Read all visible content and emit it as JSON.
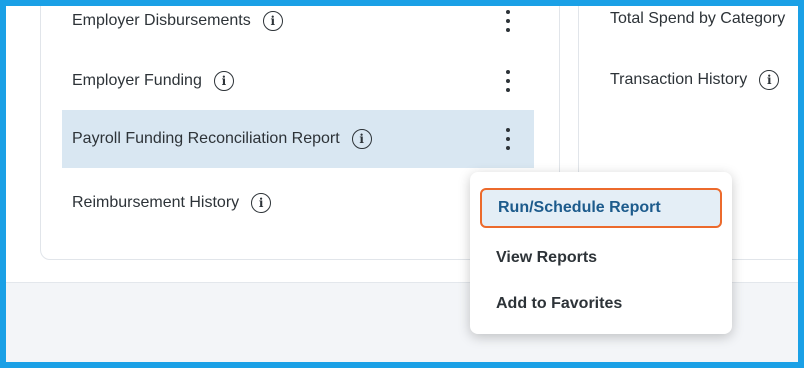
{
  "left_card": {
    "rows": [
      {
        "label": "Employer Disbursements",
        "info": "i"
      },
      {
        "label": "Employer Funding",
        "info": "i"
      },
      {
        "label": "Payroll Funding Reconciliation Report",
        "info": "i"
      },
      {
        "label": "Reimbursement History",
        "info": "i"
      }
    ]
  },
  "right_card": {
    "rows": [
      {
        "label": "Total Spend by Category"
      },
      {
        "label": "Transaction History",
        "info": "i"
      }
    ]
  },
  "context_menu": {
    "items": [
      {
        "label": "Run/Schedule Report"
      },
      {
        "label": "View Reports"
      },
      {
        "label": "Add to Favorites"
      }
    ]
  },
  "colors": {
    "frame_border": "#1aa0e6",
    "row_highlight": "#d9e7f2",
    "menu_active_bg": "#e4eef6",
    "menu_active_border": "#ec6a2c",
    "menu_active_text": "#1d5b8c",
    "text": "#2d3338"
  },
  "icons": {
    "info": "info-circle-icon",
    "more": "kebab-menu-icon"
  }
}
